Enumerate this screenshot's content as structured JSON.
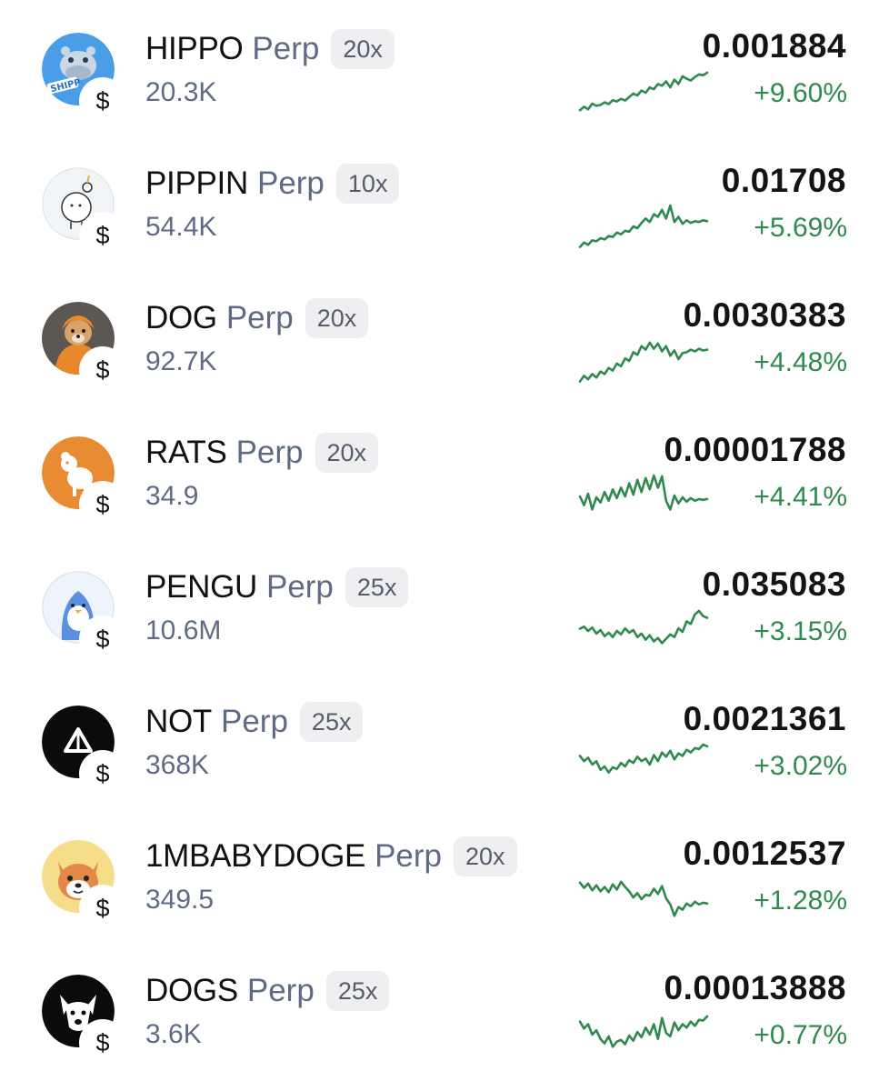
{
  "markets": [
    {
      "symbol": "HIPPO",
      "type": "Perp",
      "leverage": "20x",
      "volume": "20.3K",
      "price": "0.001884",
      "change": "+9.60%",
      "logo_icon": "hippo-icon",
      "quote_icon": "dollar-sign",
      "trend": "up",
      "spark": [
        0.1,
        0.18,
        0.12,
        0.25,
        0.2,
        0.22,
        0.28,
        0.24,
        0.33,
        0.3,
        0.36,
        0.32,
        0.4,
        0.48,
        0.44,
        0.55,
        0.5,
        0.62,
        0.58,
        0.7,
        0.66,
        0.76,
        0.62,
        0.8,
        0.7,
        0.88,
        0.82,
        0.78,
        0.86,
        0.92,
        0.9,
        0.96
      ]
    },
    {
      "symbol": "PIPPIN",
      "type": "Perp",
      "leverage": "10x",
      "volume": "54.4K",
      "price": "0.01708",
      "change": "+5.69%",
      "logo_icon": "pippin-unicorn-icon",
      "quote_icon": "dollar-sign",
      "trend": "up",
      "spark": [
        0.05,
        0.15,
        0.1,
        0.2,
        0.18,
        0.25,
        0.22,
        0.3,
        0.28,
        0.38,
        0.34,
        0.42,
        0.4,
        0.52,
        0.48,
        0.6,
        0.7,
        0.62,
        0.8,
        0.74,
        0.9,
        0.7,
        1.0,
        0.62,
        0.74,
        0.58,
        0.66,
        0.6,
        0.64,
        0.62,
        0.66,
        0.64
      ]
    },
    {
      "symbol": "DOG",
      "type": "Perp",
      "leverage": "20x",
      "volume": "92.7K",
      "price": "0.0030383",
      "change": "+4.48%",
      "logo_icon": "dog-hoodie-icon",
      "quote_icon": "dollar-sign",
      "trend": "up",
      "spark": [
        0.05,
        0.18,
        0.1,
        0.22,
        0.14,
        0.28,
        0.22,
        0.36,
        0.3,
        0.46,
        0.4,
        0.58,
        0.52,
        0.72,
        0.66,
        0.86,
        0.78,
        0.94,
        0.8,
        0.92,
        0.74,
        0.86,
        0.64,
        0.76,
        0.56,
        0.7,
        0.72,
        0.78,
        0.74,
        0.8,
        0.76,
        0.78
      ]
    },
    {
      "symbol": "RATS",
      "type": "Perp",
      "leverage": "20x",
      "volume": "34.9",
      "price": "0.00001788",
      "change": "+4.41%",
      "logo_icon": "rat-icon",
      "quote_icon": "dollar-sign",
      "trend": "up",
      "spark": [
        0.5,
        0.3,
        0.56,
        0.2,
        0.48,
        0.36,
        0.6,
        0.4,
        0.66,
        0.46,
        0.7,
        0.5,
        0.8,
        0.54,
        0.88,
        0.6,
        0.92,
        0.66,
        0.98,
        0.7,
        0.96,
        0.4,
        0.2,
        0.52,
        0.34,
        0.48,
        0.38,
        0.46,
        0.4,
        0.44,
        0.42,
        0.44
      ]
    },
    {
      "symbol": "PENGU",
      "type": "Perp",
      "leverage": "25x",
      "volume": "10.6M",
      "price": "0.035083",
      "change": "+3.15%",
      "logo_icon": "penguin-icon",
      "quote_icon": "dollar-sign",
      "trend": "up",
      "spark": [
        0.55,
        0.6,
        0.5,
        0.58,
        0.44,
        0.52,
        0.38,
        0.46,
        0.36,
        0.5,
        0.42,
        0.56,
        0.46,
        0.52,
        0.36,
        0.44,
        0.3,
        0.4,
        0.26,
        0.34,
        0.22,
        0.32,
        0.42,
        0.36,
        0.56,
        0.48,
        0.72,
        0.66,
        0.88,
        0.96,
        0.84,
        0.8
      ]
    },
    {
      "symbol": "NOT",
      "type": "Perp",
      "leverage": "25x",
      "volume": "368K",
      "price": "0.0021361",
      "change": "+3.02%",
      "logo_icon": "not-triangle-icon",
      "quote_icon": "dollar-sign",
      "trend": "up",
      "spark": [
        0.72,
        0.6,
        0.68,
        0.52,
        0.6,
        0.4,
        0.48,
        0.34,
        0.46,
        0.42,
        0.56,
        0.48,
        0.62,
        0.56,
        0.7,
        0.6,
        0.66,
        0.52,
        0.74,
        0.6,
        0.8,
        0.7,
        0.84,
        0.64,
        0.78,
        0.72,
        0.86,
        0.8,
        0.9,
        0.88,
        0.98,
        0.94
      ]
    },
    {
      "symbol": "1MBABYDOGE",
      "type": "Perp",
      "leverage": "20x",
      "volume": "349.5",
      "price": "0.0012537",
      "change": "+1.28%",
      "logo_icon": "shiba-dog-icon",
      "quote_icon": "dollar-sign",
      "trend": "up",
      "spark": [
        0.9,
        0.78,
        0.88,
        0.72,
        0.84,
        0.7,
        0.8,
        0.68,
        0.86,
        0.74,
        0.92,
        0.8,
        0.7,
        0.56,
        0.66,
        0.52,
        0.62,
        0.6,
        0.76,
        0.64,
        0.82,
        0.54,
        0.4,
        0.14,
        0.34,
        0.28,
        0.42,
        0.36,
        0.46,
        0.4,
        0.44,
        0.42
      ]
    },
    {
      "symbol": "DOGS",
      "type": "Perp",
      "leverage": "25x",
      "volume": "3.6K",
      "price": "0.00013888",
      "change": "+0.77%",
      "logo_icon": "dogs-face-icon",
      "quote_icon": "dollar-sign",
      "trend": "up",
      "spark": [
        0.8,
        0.64,
        0.74,
        0.5,
        0.6,
        0.4,
        0.3,
        0.46,
        0.22,
        0.34,
        0.38,
        0.28,
        0.48,
        0.36,
        0.56,
        0.44,
        0.66,
        0.5,
        0.74,
        0.4,
        0.88,
        0.54,
        0.46,
        0.78,
        0.6,
        0.74,
        0.66,
        0.8,
        0.7,
        0.84,
        0.82,
        0.92
      ]
    }
  ],
  "colors": {
    "positive": "#2f8a4e",
    "muted_text": "#5f6b85",
    "primary_text": "#111111",
    "leverage_bg": "#efeff2"
  }
}
